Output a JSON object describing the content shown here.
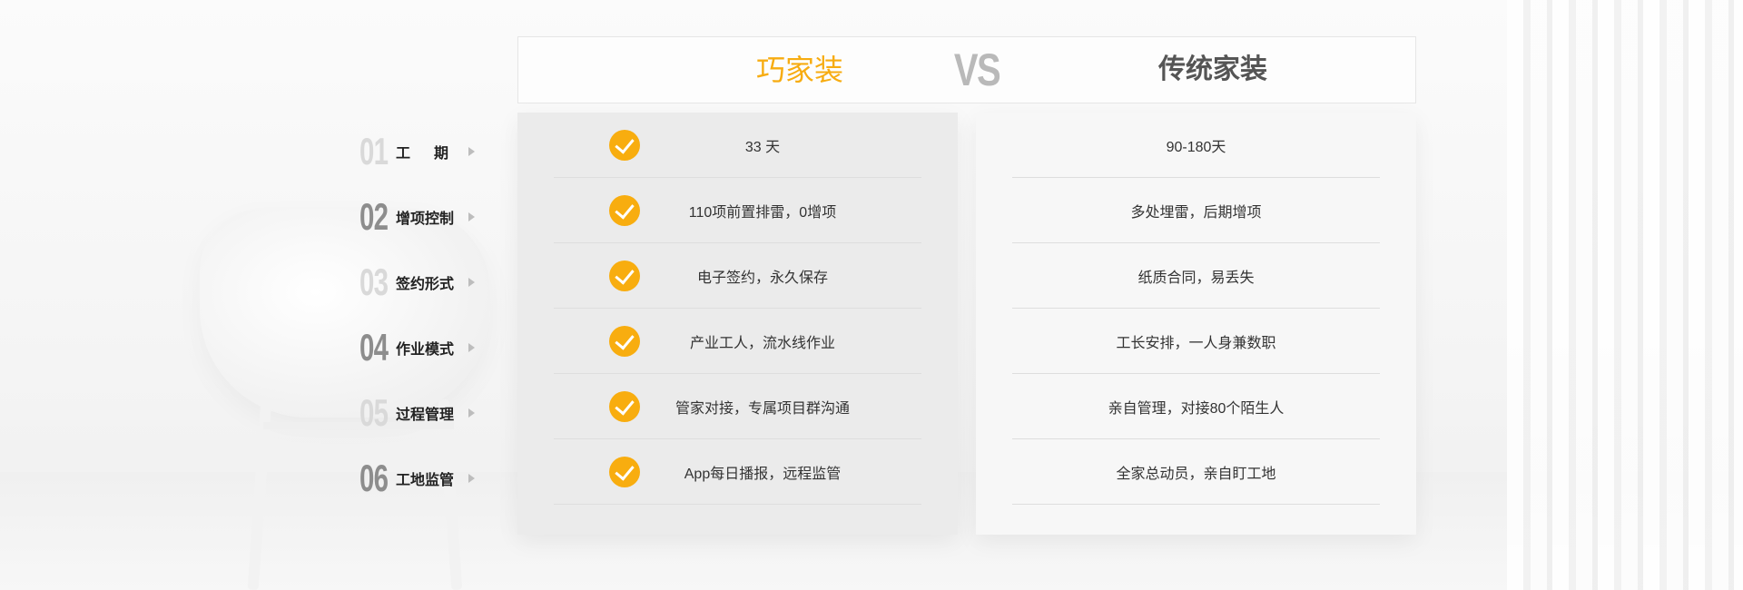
{
  "header": {
    "brand": "巧家装",
    "vs": "VS",
    "traditional": "传统家装"
  },
  "rows": [
    {
      "num": "01",
      "label": "工期",
      "brand_value": "33 天",
      "traditional_value": "90-180天"
    },
    {
      "num": "02",
      "label": "增项控制",
      "brand_value": "110项前置排雷，0增项",
      "traditional_value": "多处埋雷，后期增项"
    },
    {
      "num": "03",
      "label": "签约形式",
      "brand_value": "电子签约，永久保存",
      "traditional_value": "纸质合同，易丢失"
    },
    {
      "num": "04",
      "label": "作业模式",
      "brand_value": "产业工人，流水线作业",
      "traditional_value": "工长安排，一人身兼数职"
    },
    {
      "num": "05",
      "label": "过程管理",
      "brand_value": "管家对接，专属项目群沟通",
      "traditional_value": "亲自管理，对接80个陌生人"
    },
    {
      "num": "06",
      "label": "工地监管",
      "brand_value": "App每日播报，远程监管",
      "traditional_value": "全家总动员，亲自盯工地"
    }
  ],
  "colors": {
    "accent": "#f8ad0f",
    "vs": "#b9b9b9",
    "text": "#333333"
  },
  "icons": {
    "check": "check-circle-icon",
    "arrow": "triangle-right-icon"
  }
}
